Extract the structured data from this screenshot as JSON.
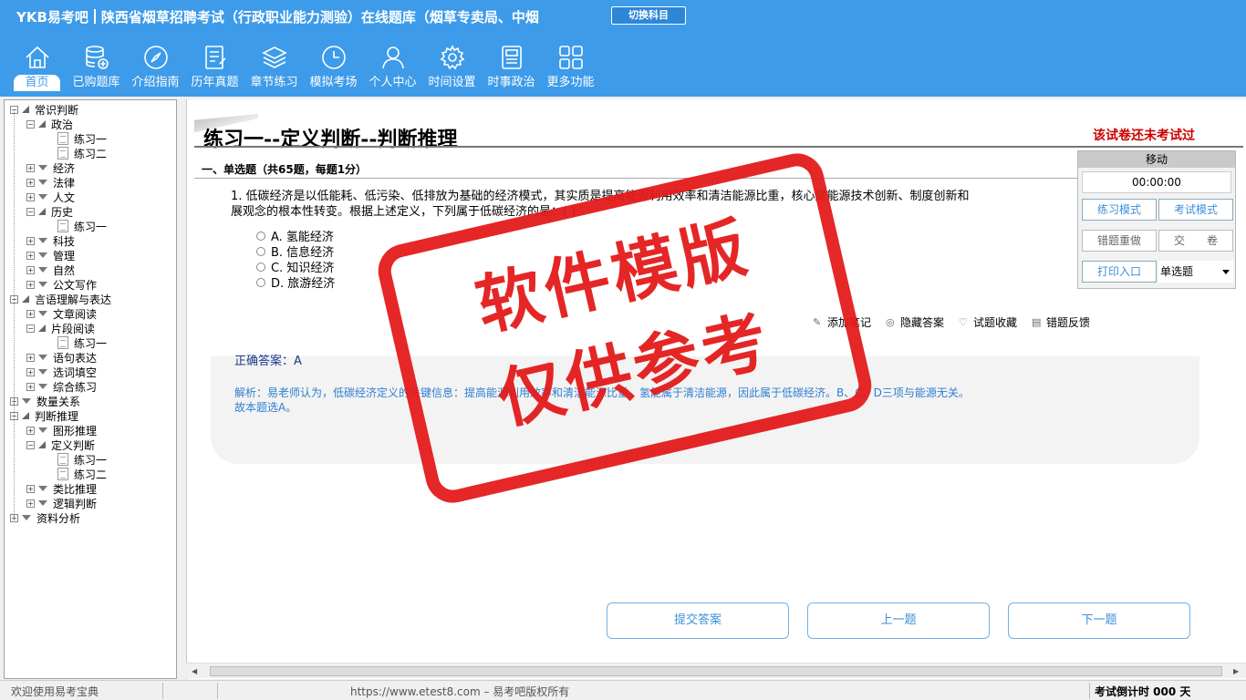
{
  "header": {
    "brand": "YKB易考吧",
    "exam_name": "陕西省烟草招聘考试（行政职业能力测验）在线题库（烟草专卖局、中烟",
    "switch_label": "切换科目"
  },
  "nav": [
    {
      "label": "首页",
      "icon": "home-icon"
    },
    {
      "label": "已购题库",
      "icon": "database-icon"
    },
    {
      "label": "介绍指南",
      "icon": "compass-icon"
    },
    {
      "label": "历年真题",
      "icon": "list-icon"
    },
    {
      "label": "章节练习",
      "icon": "layers-icon"
    },
    {
      "label": "模拟考场",
      "icon": "clock-icon"
    },
    {
      "label": "个人中心",
      "icon": "user-icon"
    },
    {
      "label": "时间设置",
      "icon": "gear-icon"
    },
    {
      "label": "时事政治",
      "icon": "news-icon"
    },
    {
      "label": "更多功能",
      "icon": "grid-icon"
    }
  ],
  "tree": [
    {
      "label": "常识判断",
      "level": 0,
      "state": "open"
    },
    {
      "label": "政治",
      "level": 1,
      "state": "open"
    },
    {
      "label": "练习一",
      "level": 2,
      "state": "leaf"
    },
    {
      "label": "练习二",
      "level": 2,
      "state": "leaf"
    },
    {
      "label": "经济",
      "level": 1,
      "state": "closed"
    },
    {
      "label": "法律",
      "level": 1,
      "state": "closed"
    },
    {
      "label": "人文",
      "level": 1,
      "state": "closed"
    },
    {
      "label": "历史",
      "level": 1,
      "state": "open"
    },
    {
      "label": "练习一",
      "level": 2,
      "state": "leaf"
    },
    {
      "label": "科技",
      "level": 1,
      "state": "closed"
    },
    {
      "label": "管理",
      "level": 1,
      "state": "closed"
    },
    {
      "label": "自然",
      "level": 1,
      "state": "closed"
    },
    {
      "label": "公文写作",
      "level": 1,
      "state": "closed"
    },
    {
      "label": "言语理解与表达",
      "level": 0,
      "state": "open"
    },
    {
      "label": "文章阅读",
      "level": 1,
      "state": "closed"
    },
    {
      "label": "片段阅读",
      "level": 1,
      "state": "open"
    },
    {
      "label": "练习一",
      "level": 2,
      "state": "leaf"
    },
    {
      "label": "语句表达",
      "level": 1,
      "state": "closed"
    },
    {
      "label": "选词填空",
      "level": 1,
      "state": "closed"
    },
    {
      "label": "综合练习",
      "level": 1,
      "state": "closed"
    },
    {
      "label": "数量关系",
      "level": 0,
      "state": "closed"
    },
    {
      "label": "判断推理",
      "level": 0,
      "state": "open"
    },
    {
      "label": "图形推理",
      "level": 1,
      "state": "closed"
    },
    {
      "label": "定义判断",
      "level": 1,
      "state": "open"
    },
    {
      "label": "练习一",
      "level": 2,
      "state": "leaf"
    },
    {
      "label": "练习二",
      "level": 2,
      "state": "leaf"
    },
    {
      "label": "类比推理",
      "level": 1,
      "state": "closed"
    },
    {
      "label": "逻辑判断",
      "level": 1,
      "state": "closed"
    },
    {
      "label": "资料分析",
      "level": 0,
      "state": "closed"
    }
  ],
  "main": {
    "title": "练习一--定义判断--判断推理",
    "status": "该试卷还未考试过",
    "section": "一、单选题（共65题，每题1分）",
    "question_line1": "1. 低碳经济是以低能耗、低污染、低排放为基础的经济模式，其实质是提高能源利用效率和清洁能源比重，核心是能源技术创新、制度创新和",
    "question_line2": "展观念的根本性转变。根据上述定义，下列属于低碳经济的是：( )",
    "options": [
      "A. 氢能经济",
      "B. 信息经济",
      "C. 知识经济",
      "D. 旅游经济"
    ],
    "tools": [
      "添加笔记",
      "隐藏答案",
      "试题收藏",
      "错题反馈"
    ],
    "answer": "正确答案：A",
    "analysis_line1": "解析：易老师认为，低碳经济定义的关键信息：提高能源利用效率和清洁能源比重。氢能属于清洁能源，因此属于低碳经济。B、C、D三项与能源无关。",
    "analysis_line2": "故本题选A。"
  },
  "panel": {
    "move": "移动",
    "timer": "00:00:00",
    "practice_mode": "练习模式",
    "exam_mode": "考试模式",
    "redo_wrong": "错题重做",
    "submit_paper": "交　　卷",
    "print": "打印入口",
    "type_selected": "单选题"
  },
  "buttons": {
    "submit": "提交答案",
    "prev": "上一题",
    "next": "下一题"
  },
  "statusbar": {
    "welcome": "欢迎使用易考宝典",
    "copyright": "https://www.etest8.com – 易考吧版权所有",
    "countdown": "考试倒计时 000 天"
  },
  "stamp": {
    "line1": "软件模版",
    "line2": "仅供参考"
  },
  "colors": {
    "header": "#3d9be9",
    "stamp": "#e41b1b",
    "status_red": "#cc0000",
    "analysis": "#2e7fd0"
  }
}
